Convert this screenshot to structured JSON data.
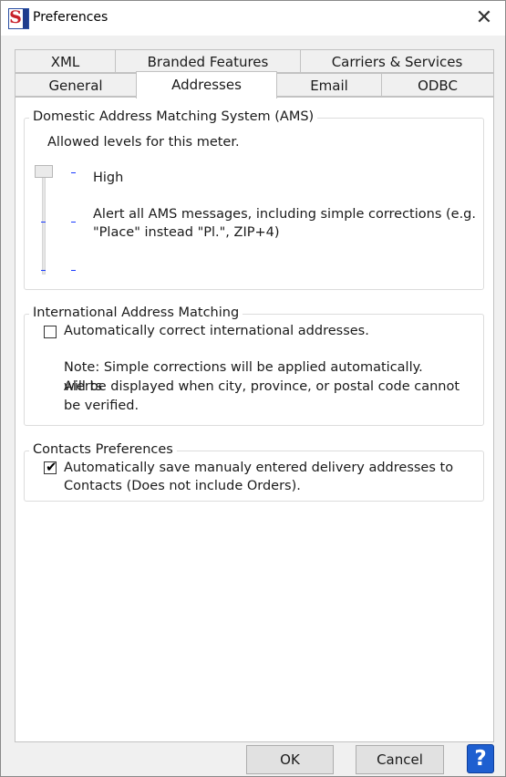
{
  "window": {
    "title": "Preferences"
  },
  "tabs": {
    "row_back": [
      "XML",
      "Branded Features",
      "Carriers & Services"
    ],
    "row_front": [
      "General",
      "Addresses",
      "Email",
      "ODBC"
    ],
    "active": "Addresses"
  },
  "ams": {
    "legend": "Domestic Address Matching System (AMS)",
    "allowed_levels": "Allowed levels for this meter.",
    "level_name": "High",
    "level_desc_line1": "Alert all AMS messages, including simple corrections (e.g.",
    "level_desc_line2": "\"Place\" instead \"Pl.\", ZIP+4)",
    "slider_level": "High"
  },
  "international": {
    "legend": "International Address Matching",
    "checkbox_label": "Automatically correct international addresses.",
    "checked": false,
    "note_line1": "Note: Simple corrections will be applied automatically. Alerts",
    "note_line2": "will be displayed when city, province, or postal code cannot",
    "note_line3": "be verified."
  },
  "contacts": {
    "legend": "Contacts Preferences",
    "checkbox_label_line1": "Automatically save manualy entered delivery addresses to",
    "checkbox_label_line2": "Contacts (Does not include Orders).",
    "checked": true
  },
  "buttons": {
    "ok": "OK",
    "cancel": "Cancel",
    "help": "?"
  },
  "colors": {
    "accent": "#1e5fd0",
    "brand_red": "#c8202a",
    "tick_blue": "#1a3bff"
  }
}
